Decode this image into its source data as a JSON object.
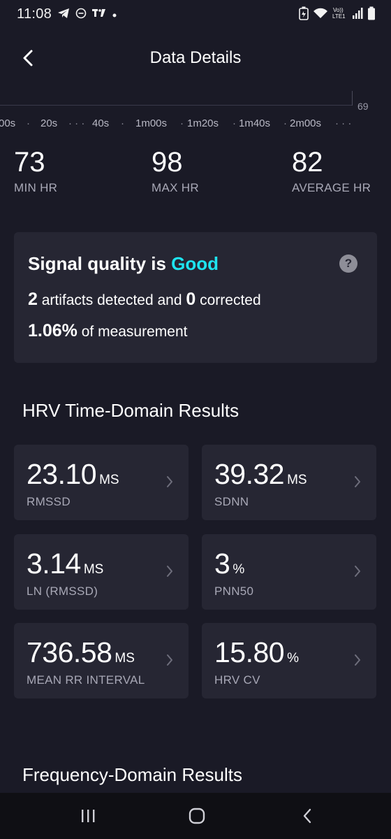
{
  "status_bar": {
    "time": "11:08",
    "left_icons": [
      "telegram-icon",
      "do-not-disturb-icon",
      "tradingview-icon",
      "notification-dot-icon"
    ],
    "right_icons": [
      "battery-saver-icon",
      "wifi-icon",
      "volte-icon",
      "signal-icon",
      "battery-icon"
    ],
    "volte_text": "Vo))\nLTE1"
  },
  "header": {
    "title": "Data Details"
  },
  "chart": {
    "y_max_label": "69",
    "time_ticks": [
      "00s",
      "20s",
      "40s",
      "1m00s",
      "1m20s",
      "1m40s",
      "2m00s"
    ],
    "tick_separators": [
      "·",
      "· · ·",
      "·",
      "·",
      "·",
      "·",
      "· · ·"
    ]
  },
  "hr_stats": [
    {
      "value": "73",
      "label": "MIN HR"
    },
    {
      "value": "98",
      "label": "MAX HR"
    },
    {
      "value": "82",
      "label": "AVERAGE HR"
    }
  ],
  "signal_quality": {
    "title_prefix": "Signal quality is ",
    "status": "Good",
    "status_color": "#1ee4f0",
    "artifacts_count": "2",
    "artifacts_text": " artifacts detected and ",
    "corrected_count": "0",
    "corrected_text": " corrected",
    "percent": "1.06%",
    "percent_text": " of measurement",
    "help_label": "?"
  },
  "time_domain": {
    "heading": "HRV Time-Domain Results",
    "metrics": [
      {
        "value": "23.10",
        "unit": "MS",
        "label": "RMSSD"
      },
      {
        "value": "39.32",
        "unit": "MS",
        "label": "SDNN"
      },
      {
        "value": "3.14",
        "unit": "MS",
        "label": "LN (RMSSD)"
      },
      {
        "value": "3",
        "unit": "%",
        "label": "PNN50"
      },
      {
        "value": "736.58",
        "unit": "MS",
        "label": "MEAN RR INTERVAL"
      },
      {
        "value": "15.80",
        "unit": "%",
        "label": "HRV CV"
      }
    ]
  },
  "frequency_domain": {
    "heading": "Frequency-Domain Results"
  },
  "nav_bar": {
    "buttons": [
      "recent-apps",
      "home",
      "back"
    ]
  }
}
